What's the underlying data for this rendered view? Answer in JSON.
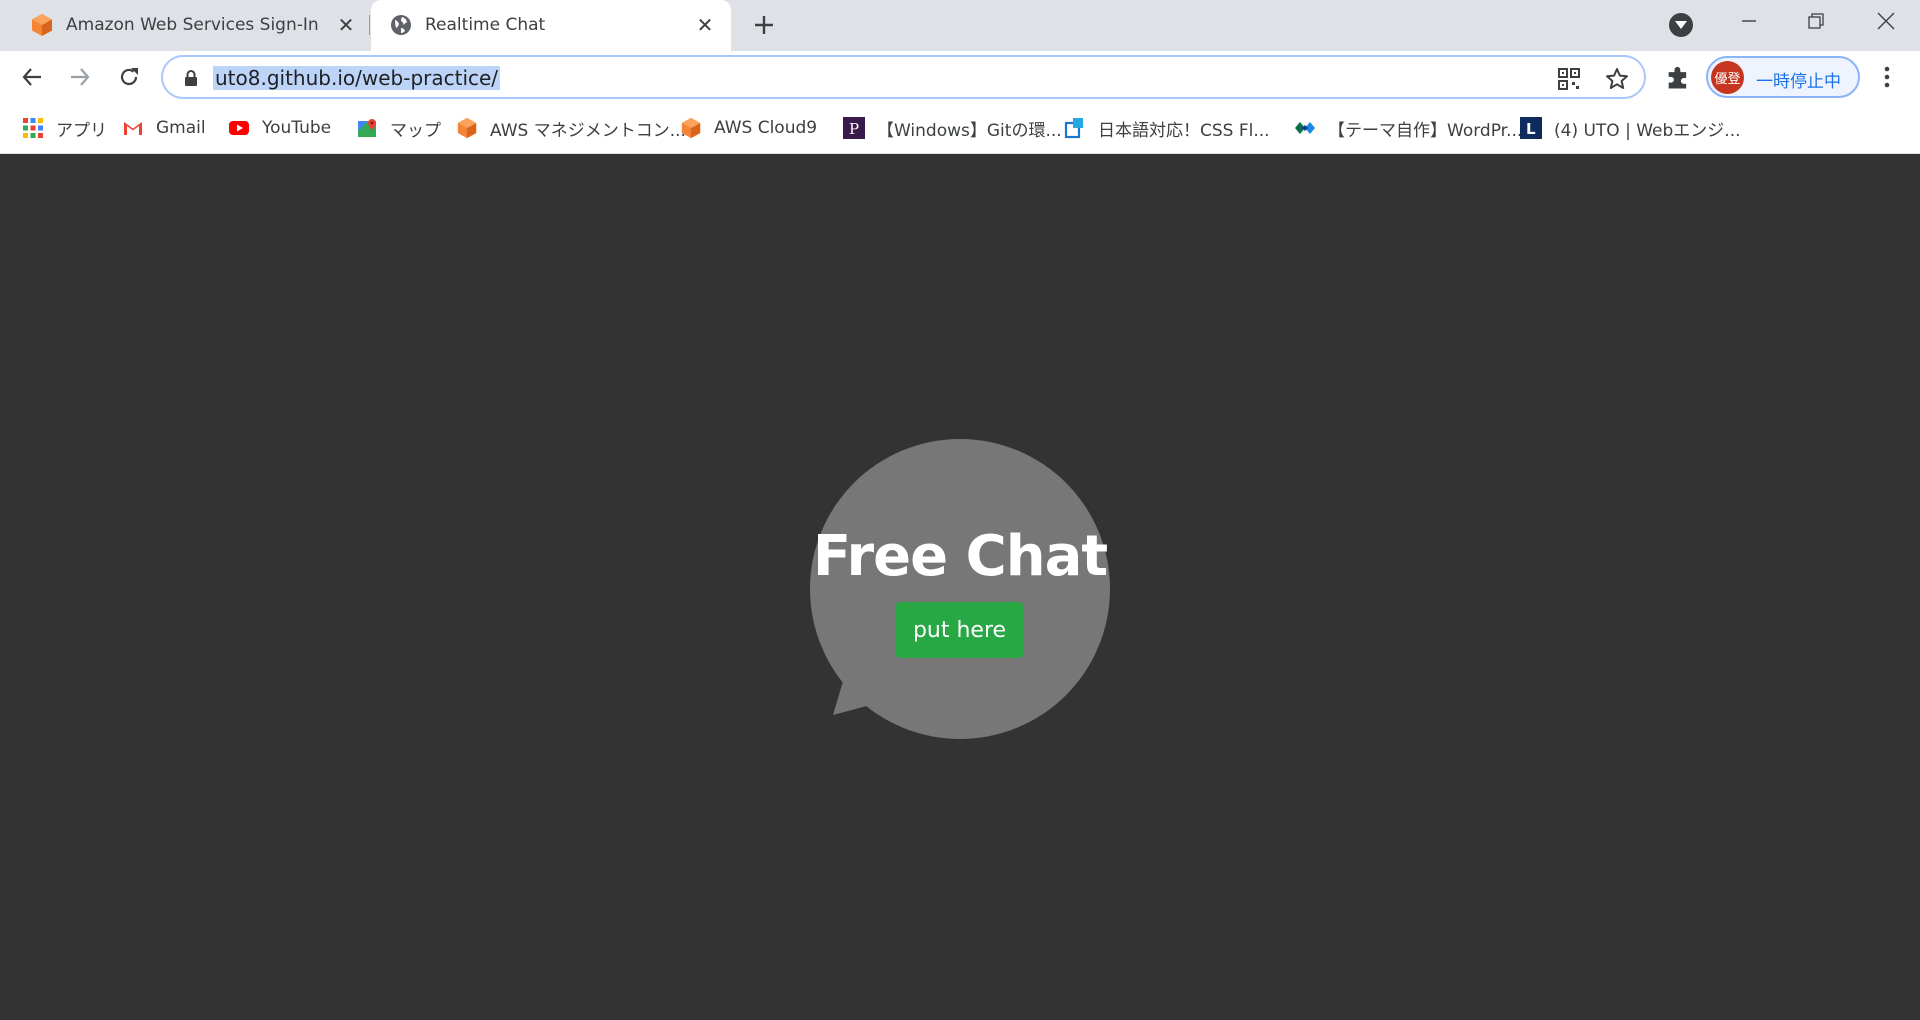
{
  "browser": {
    "tabs": [
      {
        "title": "Amazon Web Services Sign-In",
        "icon": "aws-cube-icon",
        "active": false
      },
      {
        "title": "Realtime Chat",
        "icon": "globe-icon",
        "active": true
      }
    ],
    "address_bar": {
      "url": "uto8.github.io/web-practice/"
    },
    "profile": {
      "avatar_text": "優登",
      "status": "一時停止中"
    },
    "bookmarks": [
      {
        "label": "アプリ",
        "icon": "apps-grid-icon"
      },
      {
        "label": "Gmail",
        "icon": "gmail-icon"
      },
      {
        "label": "YouTube",
        "icon": "youtube-icon"
      },
      {
        "label": "マップ",
        "icon": "maps-icon"
      },
      {
        "label": "AWS マネジメントコン...",
        "icon": "aws-cube-icon"
      },
      {
        "label": "AWS Cloud9",
        "icon": "aws-cube-icon"
      },
      {
        "label": "【Windows】Gitの環...",
        "icon": "p-logo-icon"
      },
      {
        "label": "日本語対応！CSS Fl...",
        "icon": "square-logo-icon"
      },
      {
        "label": "【テーマ自作】WordPr...",
        "icon": "diamond-logo-icon"
      },
      {
        "label": "(4) UTO | Webエンジ...",
        "icon": "l-logo-icon"
      }
    ]
  },
  "page": {
    "title": "Free Chat",
    "button_label": "put here"
  },
  "colors": {
    "page_bg": "#333333",
    "bubble": "#777777",
    "button": "#28a745",
    "tabstrip": "#dee1e6",
    "url_highlight": "#bcd4f8"
  }
}
